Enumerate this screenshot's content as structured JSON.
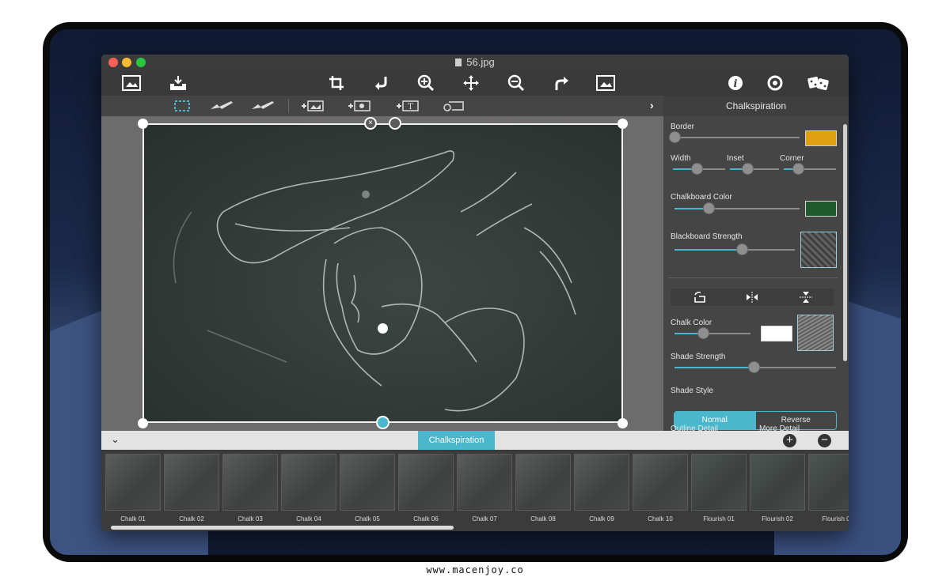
{
  "window": {
    "title": "56.jpg"
  },
  "toolbar": {
    "left": [
      "open-image-icon",
      "save-tray-icon"
    ],
    "center": [
      "crop-icon",
      "undo-icon",
      "zoom-in-icon",
      "move-icon",
      "zoom-out-icon",
      "redo-icon",
      "fit-image-icon"
    ],
    "right": [
      "info-icon",
      "help-icon",
      "dice-icon"
    ]
  },
  "subbar": {
    "tools": [
      "select-rect-icon",
      "brush-add-icon",
      "brush-remove-icon",
      "add-image-icon",
      "add-burst-icon",
      "add-text-icon",
      "add-tag-icon"
    ]
  },
  "panel": {
    "title": "Chalkspiration",
    "border_label": "Border",
    "border_color": "#e0a010",
    "width_label": "Width",
    "inset_label": "Inset",
    "corner_label": "Corner",
    "chalkboard_color_label": "Chalkboard Color",
    "chalkboard_color": "#1f5a2c",
    "blackboard_strength_label": "Blackboard Strength",
    "chalk_color_label": "Chalk Color",
    "chalk_color": "#ffffff",
    "shade_strength_label": "Shade Strength",
    "shade_style_label": "Shade Style",
    "shade_style_options": [
      "Normal",
      "Reverse"
    ],
    "shade_style_selected": "Normal",
    "outline_detail_label": "Outline Detail",
    "more_detail_label": "More Detail",
    "sliders": {
      "border": 0.0,
      "width": 0.45,
      "inset": 0.35,
      "corner": 0.28,
      "chalkboard_color": 0.27,
      "blackboard_strength": 0.56,
      "chalk_color": 0.38,
      "shade_strength": 0.49
    }
  },
  "strip": {
    "label": "Chalkspiration",
    "add_icon": "plus-icon",
    "remove_icon": "minus-icon"
  },
  "presets": [
    "Chalk 01",
    "Chalk 02",
    "Chalk 03",
    "Chalk 04",
    "Chalk 05",
    "Chalk 06",
    "Chalk 07",
    "Chalk 08",
    "Chalk 09",
    "Chalk 10",
    "Flourish 01",
    "Flourish 02",
    "Flourish 0"
  ],
  "footer": {
    "watermark": "www.macenjoy.co"
  }
}
